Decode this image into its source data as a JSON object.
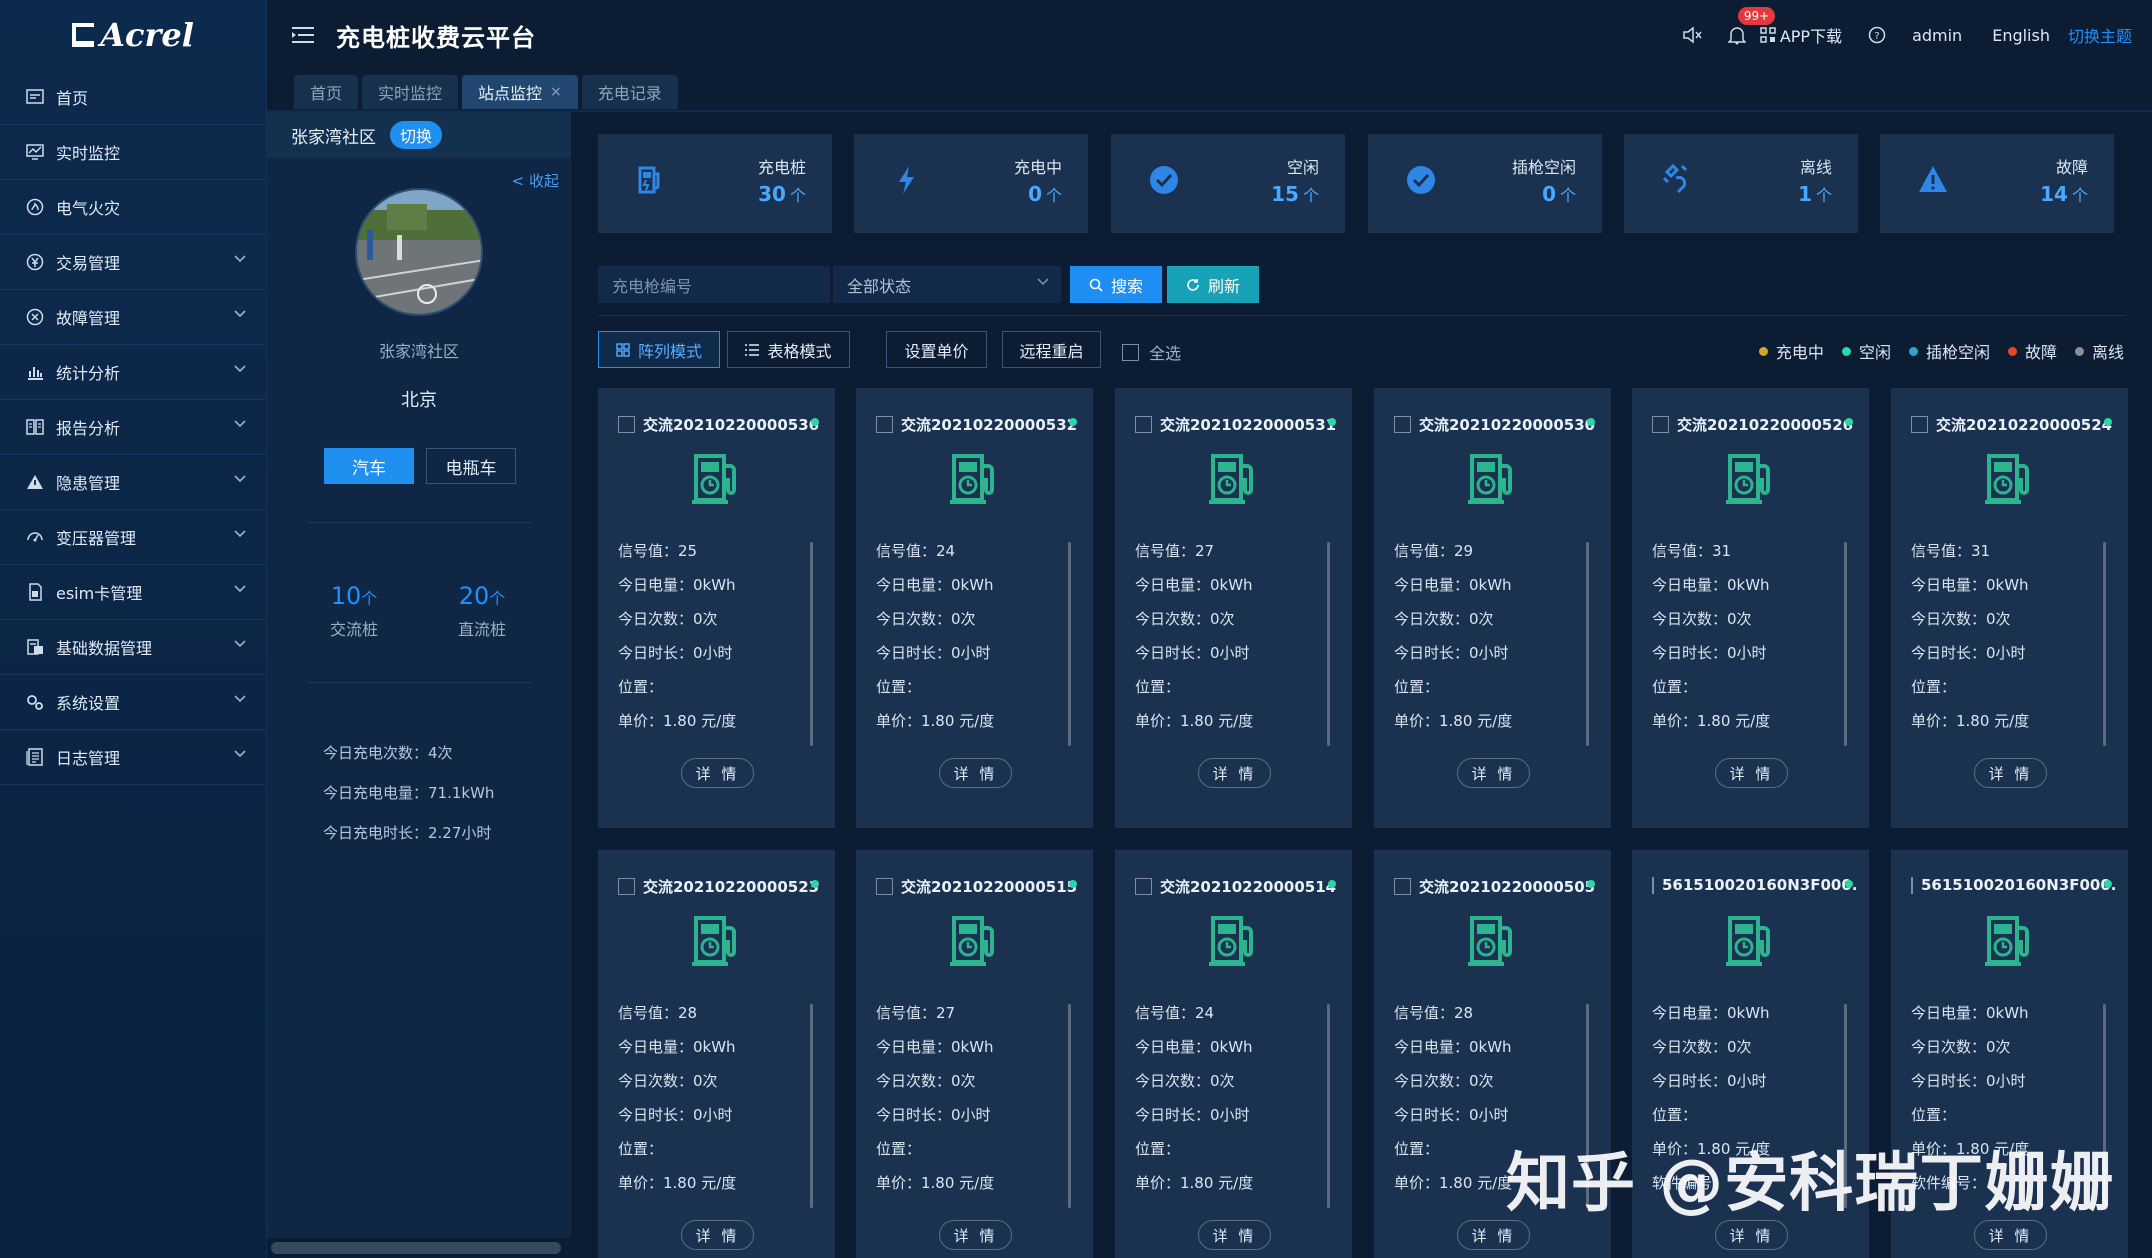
{
  "app": {
    "logo_text": "Acrel",
    "title": "充电桩收费云平台"
  },
  "topbar": {
    "notification_count": "99+",
    "app_download": "APP下载",
    "user": "admin",
    "language": "English",
    "theme_switch": "切换主题"
  },
  "sidebar": {
    "items": [
      {
        "label": "首页",
        "icon": "home-icon"
      },
      {
        "label": "实时监控",
        "icon": "monitor-icon"
      },
      {
        "label": "电气火灾",
        "icon": "fire-icon"
      },
      {
        "label": "交易管理",
        "icon": "money-icon"
      },
      {
        "label": "故障管理",
        "icon": "fault-icon"
      },
      {
        "label": "统计分析",
        "icon": "bar-chart-icon"
      },
      {
        "label": "报告分析",
        "icon": "report-icon"
      },
      {
        "label": "隐患管理",
        "icon": "warning-icon"
      },
      {
        "label": "变压器管理",
        "icon": "transformer-icon"
      },
      {
        "label": "esim卡管理",
        "icon": "sim-card-icon"
      },
      {
        "label": "基础数据管理",
        "icon": "database-icon"
      },
      {
        "label": "系统设置",
        "icon": "gear-icon"
      },
      {
        "label": "日志管理",
        "icon": "log-icon"
      }
    ]
  },
  "tabs": [
    {
      "label": "首页"
    },
    {
      "label": "实时监控"
    },
    {
      "label": "站点监控",
      "close": "×"
    },
    {
      "label": "充电记录"
    }
  ],
  "station": {
    "name": "张家湾社区",
    "switch_label": "切换",
    "collapse": "< 收起",
    "site_name": "张家湾社区",
    "city": "北京",
    "vehicle_car": "汽车",
    "vehicle_ebike": "电瓶车",
    "ac_count": "10",
    "dc_count": "20",
    "unit": "个",
    "ac_label": "交流桩",
    "dc_label": "直流桩",
    "today_times": "今日充电次数：4次",
    "today_energy": "今日充电电量：71.1kWh",
    "today_duration": "今日充电时长：2.27小时"
  },
  "stats": [
    {
      "label": "充电桩",
      "value": "30",
      "icon": "charger-icon",
      "color": "#2e86e6"
    },
    {
      "label": "充电中",
      "value": "0",
      "icon": "lightning-icon",
      "color": "#2e86e6"
    },
    {
      "label": "空闲",
      "value": "15",
      "icon": "check-circle-icon",
      "color": "#2e86e6"
    },
    {
      "label": "插枪空闲",
      "value": "0",
      "icon": "check-circle-icon",
      "color": "#2e86e6"
    },
    {
      "label": "离线",
      "value": "1",
      "icon": "unplug-icon",
      "color": "#2e86e6"
    },
    {
      "label": "故障",
      "value": "14",
      "icon": "alert-triangle-icon",
      "color": "#2e86e6"
    }
  ],
  "stat_unit": "个",
  "filters": {
    "gun_placeholder": "充电枪编号",
    "status_value": "全部状态",
    "search_label": "搜索",
    "refresh_label": "刷新"
  },
  "toolbar": {
    "array_mode": "阵列模式",
    "table_mode": "表格模式",
    "set_price": "设置单价",
    "remote_restart": "远程重启",
    "select_all": "全选"
  },
  "legend": [
    {
      "label": "充电中",
      "color": "#d4a62a"
    },
    {
      "label": "空闲",
      "color": "#2bd6a7"
    },
    {
      "label": "插枪空闲",
      "color": "#2aa7c9"
    },
    {
      "label": "故障",
      "color": "#e8452b"
    },
    {
      "label": "离线",
      "color": "#8a8f98"
    }
  ],
  "cards": [
    {
      "name": "交流20210220000536",
      "lines": [
        "信号值：25",
        "今日电量：0kWh",
        "今日次数：0次",
        "今日时长：0小时",
        "位置：",
        "单价：1.80 元/度"
      ],
      "detail": "详 情"
    },
    {
      "name": "交流20210220000532",
      "lines": [
        "信号值：24",
        "今日电量：0kWh",
        "今日次数：0次",
        "今日时长：0小时",
        "位置：",
        "单价：1.80 元/度"
      ],
      "detail": "详 情"
    },
    {
      "name": "交流20210220000531",
      "lines": [
        "信号值：27",
        "今日电量：0kWh",
        "今日次数：0次",
        "今日时长：0小时",
        "位置：",
        "单价：1.80 元/度"
      ],
      "detail": "详 情"
    },
    {
      "name": "交流20210220000530",
      "lines": [
        "信号值：29",
        "今日电量：0kWh",
        "今日次数：0次",
        "今日时长：0小时",
        "位置：",
        "单价：1.80 元/度"
      ],
      "detail": "详 情"
    },
    {
      "name": "交流20210220000526",
      "lines": [
        "信号值：31",
        "今日电量：0kWh",
        "今日次数：0次",
        "今日时长：0小时",
        "位置：",
        "单价：1.80 元/度"
      ],
      "detail": "详 情"
    },
    {
      "name": "交流20210220000524",
      "lines": [
        "信号值：31",
        "今日电量：0kWh",
        "今日次数：0次",
        "今日时长：0小时",
        "位置：",
        "单价：1.80 元/度"
      ],
      "detail": "详 情"
    },
    {
      "name": "交流20210220000523",
      "lines": [
        "信号值：28",
        "今日电量：0kWh",
        "今日次数：0次",
        "今日时长：0小时",
        "位置：",
        "单价：1.80 元/度"
      ],
      "detail": "详 情"
    },
    {
      "name": "交流20210220000515",
      "lines": [
        "信号值：27",
        "今日电量：0kWh",
        "今日次数：0次",
        "今日时长：0小时",
        "位置：",
        "单价：1.80 元/度"
      ],
      "detail": "详 情"
    },
    {
      "name": "交流20210220000514",
      "lines": [
        "信号值：24",
        "今日电量：0kWh",
        "今日次数：0次",
        "今日时长：0小时",
        "位置：",
        "单价：1.80 元/度"
      ],
      "detail": "详 情"
    },
    {
      "name": "交流20210220000505",
      "lines": [
        "信号值：28",
        "今日电量：0kWh",
        "今日次数：0次",
        "今日时长：0小时",
        "位置：",
        "单价：1.80 元/度"
      ],
      "detail": "详 情"
    },
    {
      "name": "561510020160N3F000...",
      "lines": [
        "今日电量：0kWh",
        "今日次数：0次",
        "今日时长：0小时",
        "位置：",
        "单价：1.80 元/度",
        "软件编号："
      ],
      "detail": "详 情"
    },
    {
      "name": "561510020160N3F000...",
      "lines": [
        "今日电量：0kWh",
        "今日次数：0次",
        "今日时长：0小时",
        "位置：",
        "单价：1.80 元/度",
        "软件编号："
      ],
      "detail": "详 情"
    }
  ],
  "watermark": "知乎 @安科瑞丁姗姗"
}
